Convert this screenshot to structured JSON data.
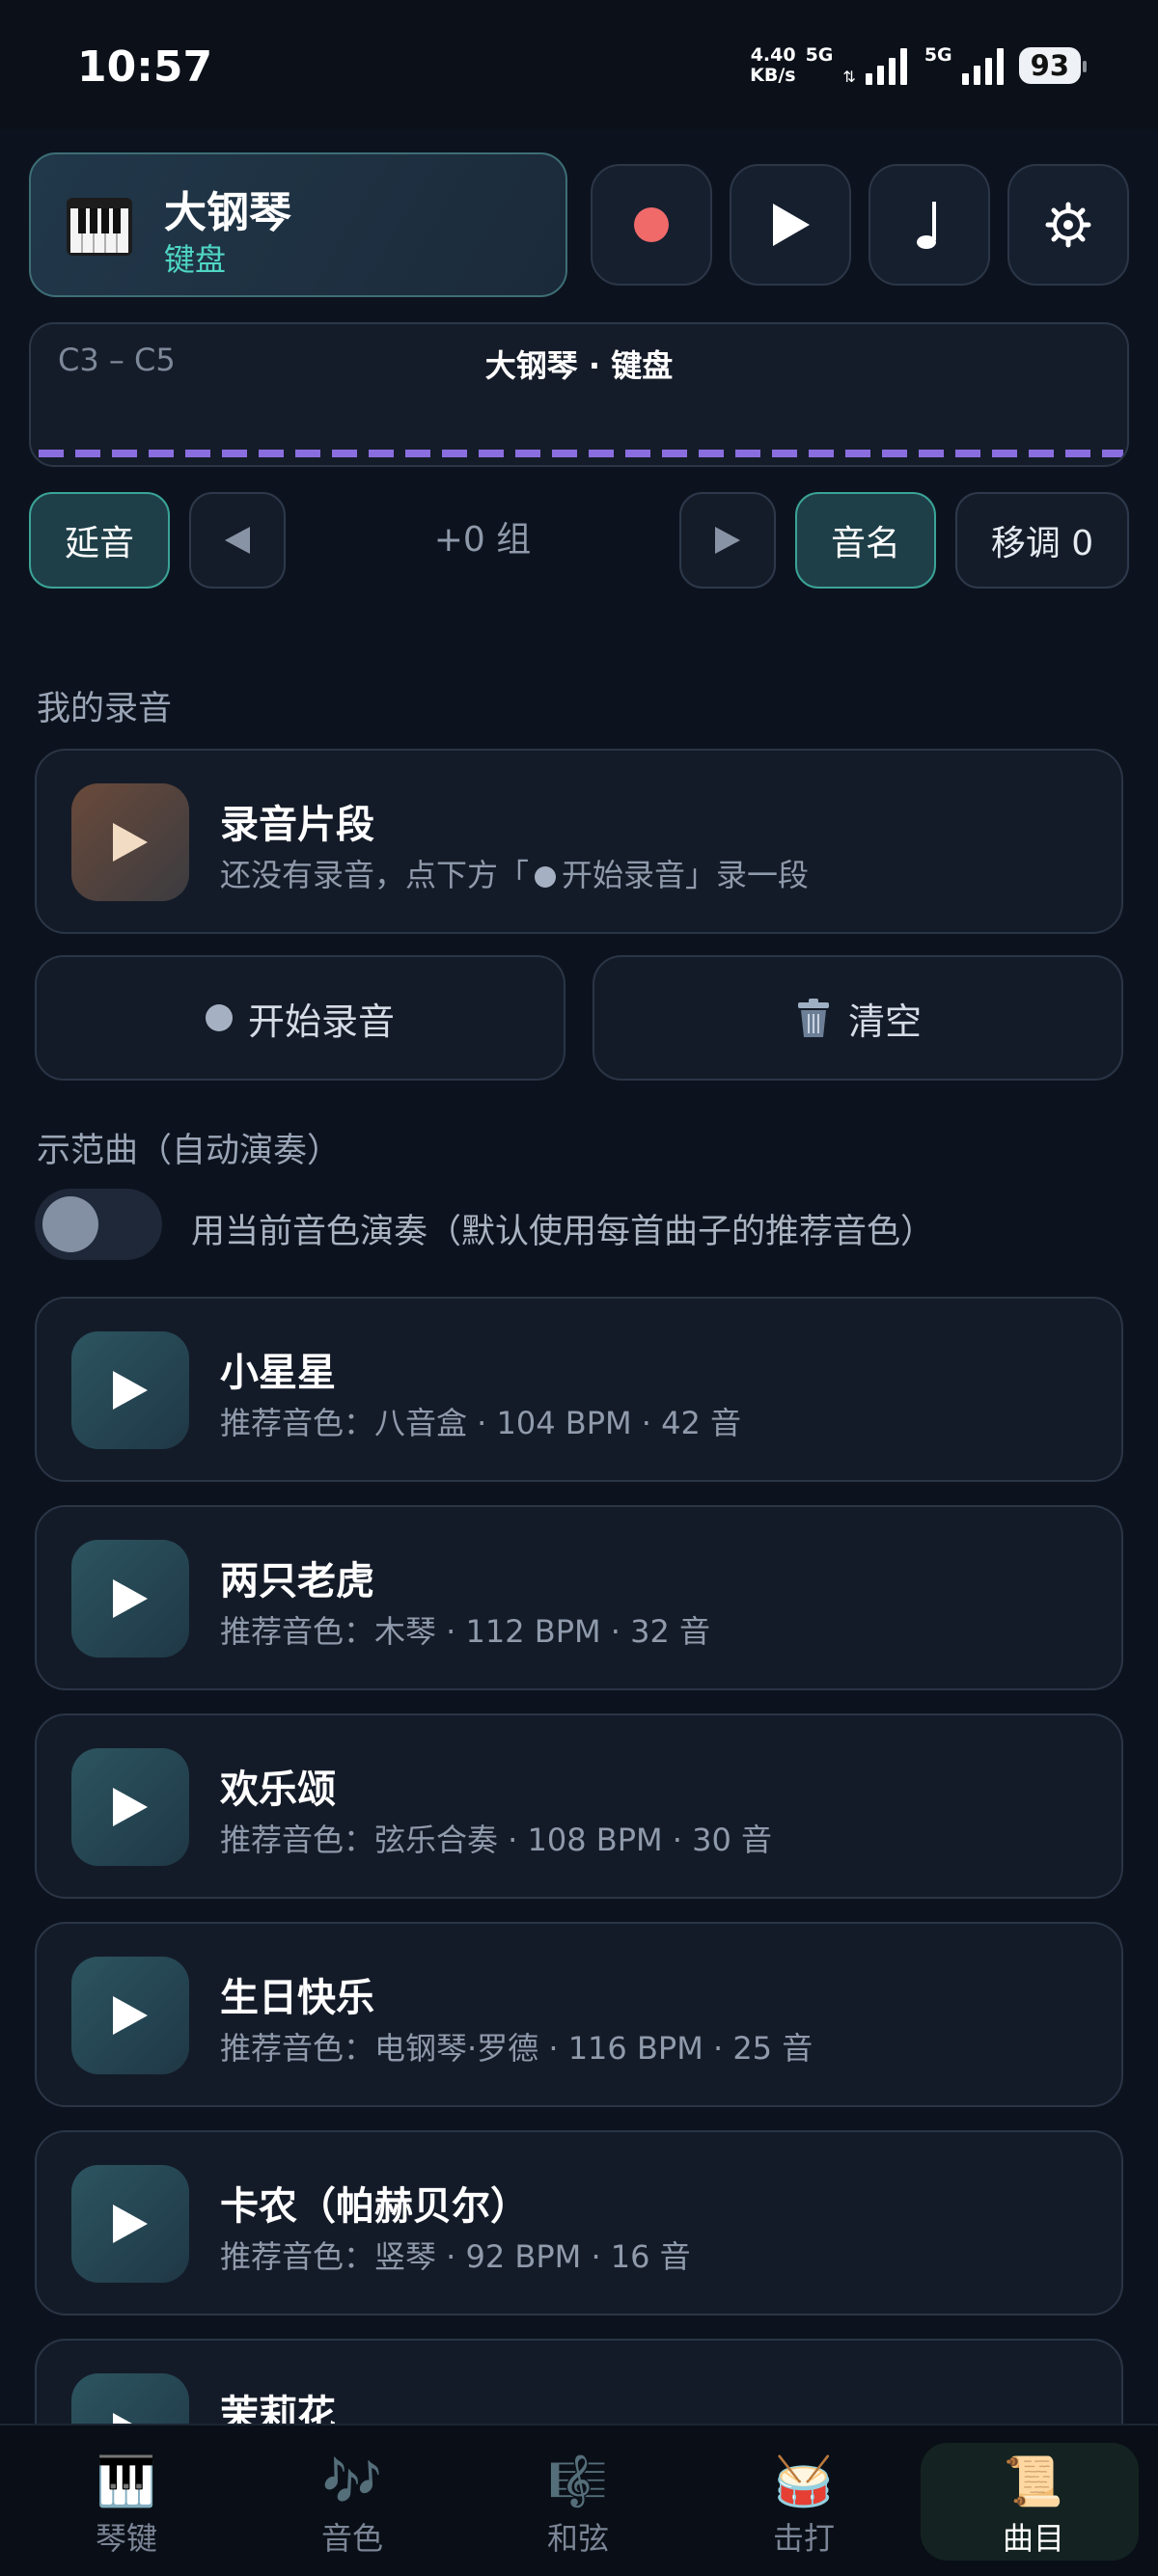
{
  "status": {
    "time": "10:57",
    "net_speed_value": "4.40",
    "net_speed_unit": "KB/s",
    "network1": "5G",
    "network2": "5G",
    "battery": "93"
  },
  "header": {
    "instrument_name": "大钢琴",
    "instrument_mode": "键盘",
    "instrument_icon": "piano-icon",
    "buttons": [
      "record-icon",
      "play-icon",
      "note-icon",
      "settings-icon"
    ]
  },
  "range": {
    "label": "C3 – C5",
    "title": "大钢琴 · 键盘"
  },
  "controls": {
    "sustain": "延音",
    "group": "+0 组",
    "note_names": "音名",
    "transpose": "移调 0"
  },
  "recordings": {
    "section_title": "我的录音",
    "clip_title": "录音片段",
    "clip_hint_before": "还没有录音，点下方「",
    "clip_hint_after": "开始录音」录一段",
    "start_record": "开始录音",
    "clear": "清空"
  },
  "demos": {
    "section_title": "示范曲（自动演奏）",
    "toggle_label": "用当前音色演奏（默认使用每首曲子的推荐音色）",
    "toggle_on": false,
    "songs": [
      {
        "title": "小星星",
        "sub": "推荐音色：八音盒 · 104 BPM · 42 音"
      },
      {
        "title": "两只老虎",
        "sub": "推荐音色：木琴 · 112 BPM · 32 音"
      },
      {
        "title": "欢乐颂",
        "sub": "推荐音色：弦乐合奏 · 108 BPM · 30 音"
      },
      {
        "title": "生日快乐",
        "sub": "推荐音色：电钢琴·罗德 · 116 BPM · 25 音"
      },
      {
        "title": "卡农（帕赫贝尔）",
        "sub": "推荐音色：竖琴 · 92 BPM · 16 音"
      },
      {
        "title": "茉莉花",
        "sub": ""
      }
    ]
  },
  "nav": [
    {
      "label": "琴键",
      "icon": "🎹"
    },
    {
      "label": "音色",
      "icon": "🎶"
    },
    {
      "label": "和弦",
      "icon": "🎼"
    },
    {
      "label": "击打",
      "icon": "🥁"
    },
    {
      "label": "曲目",
      "icon": "📜"
    }
  ],
  "colors": {
    "accent": "#4fd6c4",
    "record": "#f06a6a",
    "range_dash": "#8a6ee0"
  }
}
